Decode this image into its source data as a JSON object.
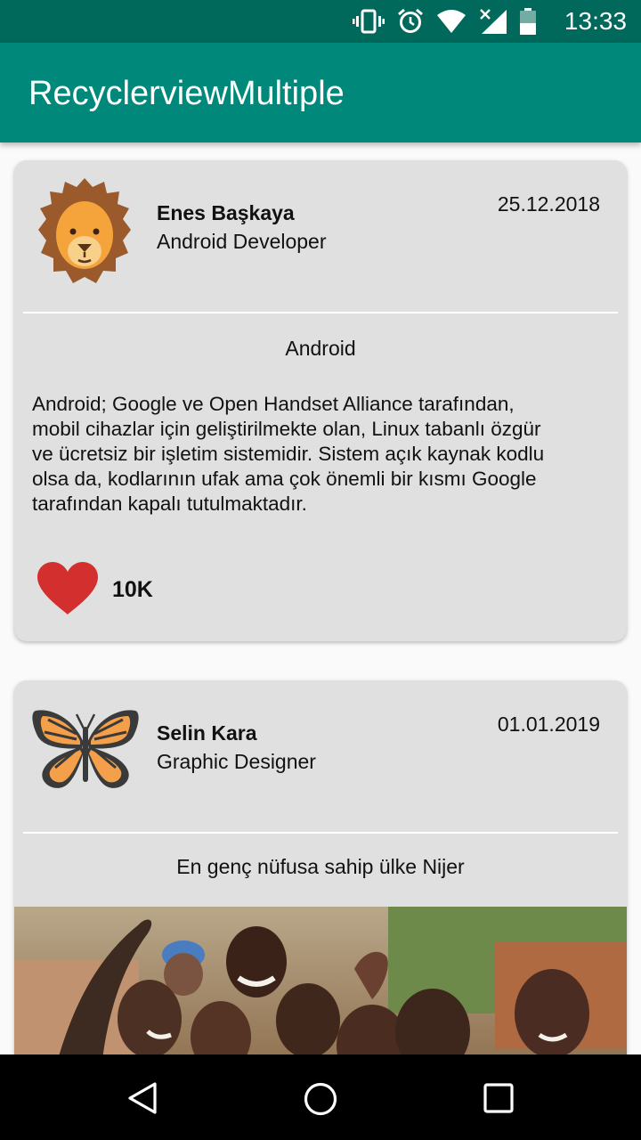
{
  "status_bar": {
    "time": "13:33",
    "icons": [
      "vibrate-icon",
      "alarm-icon",
      "wifi-icon",
      "signal-icon",
      "battery-icon"
    ]
  },
  "app_bar": {
    "title": "RecyclerviewMultiple"
  },
  "posts": [
    {
      "avatar": "lion-icon",
      "name": "Enes Başkaya",
      "role": "Android Developer",
      "date": "25.12.2018",
      "title": "Android",
      "body_lines": [
        "Android; Google ve Open Handset Alliance tarafından,",
        "mobil cihazlar için geliştirilmekte olan, Linux tabanlı özgür",
        "ve ücretsiz bir işletim sistemidir. Sistem açık kaynak kodlu",
        "olsa da, kodlarının ufak ama çok önemli bir kısmı Google",
        "tarafından kapalı tutulmaktadır."
      ],
      "like_icon": "heart-icon",
      "likes": "10K"
    },
    {
      "avatar": "butterfly-icon",
      "name": "Selin Kara",
      "role": "Graphic Designer",
      "date": "01.01.2019",
      "title": "En genç nüfusa sahip ülke Nijer"
    }
  ],
  "nav_bar": {
    "icons": [
      "back-icon",
      "home-icon",
      "recents-icon"
    ]
  },
  "colors": {
    "status_bar": "#00695c",
    "app_bar": "#00897b",
    "card": "#e0e0e0",
    "heart": "#d32f2f"
  }
}
